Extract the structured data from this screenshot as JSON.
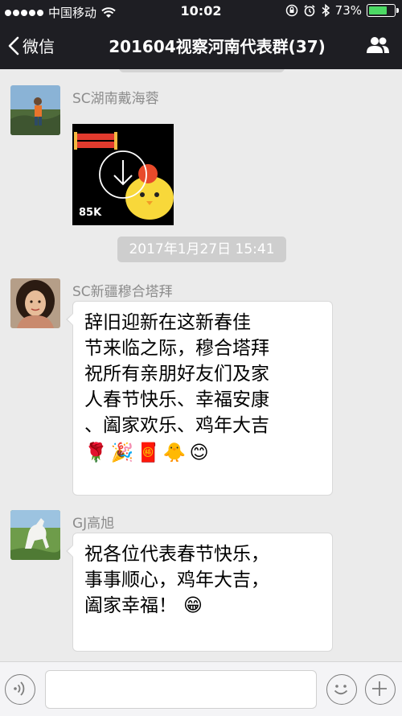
{
  "status_bar": {
    "carrier": "中国移动",
    "time": "10:02",
    "battery_percent": "73%",
    "battery_level": 0.73,
    "icons": [
      "signal-dots-icon",
      "wifi-icon",
      "orientation-lock-icon",
      "alarm-icon",
      "bluetooth-icon",
      "battery-icon"
    ]
  },
  "nav": {
    "back_label": "微信",
    "title": "201604视察河南代表群(37)",
    "people_icon": "group-people-icon"
  },
  "messages": [
    {
      "sender": "SC湖南戴海蓉",
      "type": "sticker",
      "size_label": "85K",
      "icons": [
        "download-arrow-icon",
        "yellow-chick-sticker"
      ]
    },
    {
      "sender": "SC新疆穆合塔拜",
      "type": "text",
      "lines": [
        "辞旧迎新在这新春佳",
        "节来临之际，穆合塔拜",
        "祝所有亲朋好友们及家",
        "人春节快乐、幸福安康",
        "、阖家欢乐、鸡年大吉"
      ],
      "emojis": [
        "🌹",
        "🎉",
        "🧧",
        "🐥",
        "😊"
      ]
    },
    {
      "sender": "GJ高旭",
      "type": "text",
      "lines": [
        "祝各位代表春节快乐，",
        "事事顺心，鸡年大吉，",
        "阖家幸福！"
      ],
      "emojis": [
        "😁"
      ]
    }
  ],
  "timestamp": "2017年1月27日 15:41",
  "input_bar": {
    "placeholder": "",
    "icons": [
      "voice-icon",
      "emoji-icon",
      "plus-icon"
    ]
  },
  "colors": {
    "bar_bg": "#1e1e23",
    "chat_bg": "#ebebeb",
    "bubble_bg": "#ffffff",
    "timestamp_bg": "#cecece",
    "battery_green": "#4cd964"
  }
}
